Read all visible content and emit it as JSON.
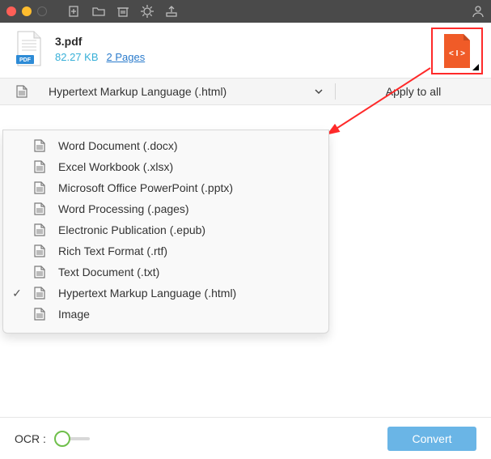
{
  "file": {
    "name": "3.pdf",
    "size": "82.27 KB",
    "pages_link": "2 Pages"
  },
  "format_selector": {
    "selected_label": "Hypertext Markup Language (.html)",
    "apply_all_label": "Apply to all"
  },
  "dropdown": {
    "items": [
      {
        "label": "Word Document (.docx)",
        "checked": false
      },
      {
        "label": "Excel Workbook (.xlsx)",
        "checked": false
      },
      {
        "label": "Microsoft Office PowerPoint (.pptx)",
        "checked": false
      },
      {
        "label": "Word Processing (.pages)",
        "checked": false
      },
      {
        "label": "Electronic Publication (.epub)",
        "checked": false
      },
      {
        "label": "Rich Text Format (.rtf)",
        "checked": false
      },
      {
        "label": "Text Document (.txt)",
        "checked": false
      },
      {
        "label": "Hypertext Markup Language (.html)",
        "checked": true
      },
      {
        "label": "Image",
        "checked": false
      }
    ]
  },
  "footer": {
    "ocr_label": "OCR :",
    "ocr_on": false,
    "convert_label": "Convert"
  },
  "colors": {
    "accent_blue": "#6ab5e6",
    "html_orange": "#f05b28",
    "callout_red": "#ff2a2a"
  }
}
